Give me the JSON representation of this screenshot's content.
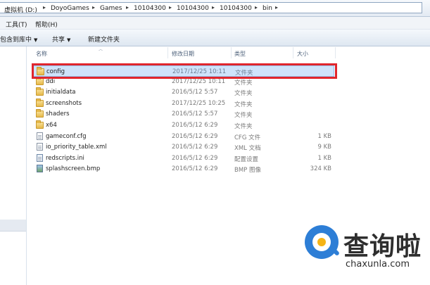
{
  "address_bar": {
    "crumbs": [
      "虚拟机 (D:)",
      "DoyoGames",
      "Games",
      "10104300",
      "10104300",
      "10104300",
      "bin"
    ]
  },
  "menu": {
    "items": [
      "工具(T)",
      "帮助(H)"
    ]
  },
  "toolbar": {
    "include_in_library": "包含到库中",
    "share": "共享",
    "new_folder": "新建文件夹"
  },
  "columns": {
    "name": "名称",
    "date": "修改日期",
    "type": "类型",
    "size": "大小"
  },
  "files": [
    {
      "name": "config",
      "date": "2017/12/25 10:11",
      "type": "文件夹",
      "size": "",
      "icon": "folder-icon",
      "selected": true
    },
    {
      "name": "ddi",
      "date": "2017/12/25 10:11",
      "type": "文件夹",
      "size": "",
      "icon": "folder-icon"
    },
    {
      "name": "initialdata",
      "date": "2016/5/12 5:57",
      "type": "文件夹",
      "size": "",
      "icon": "folder-icon"
    },
    {
      "name": "screenshots",
      "date": "2017/12/25 10:25",
      "type": "文件夹",
      "size": "",
      "icon": "folder-icon"
    },
    {
      "name": "shaders",
      "date": "2016/5/12 5:57",
      "type": "文件夹",
      "size": "",
      "icon": "folder-icon"
    },
    {
      "name": "x64",
      "date": "2016/5/12 6:29",
      "type": "文件夹",
      "size": "",
      "icon": "folder-icon"
    },
    {
      "name": "gameconf.cfg",
      "date": "2016/5/12 6:29",
      "type": "CFG 文件",
      "size": "1 KB",
      "icon": "file-icon"
    },
    {
      "name": "io_priority_table.xml",
      "date": "2016/5/12 6:29",
      "type": "XML 文档",
      "size": "9 KB",
      "icon": "xml-file-icon"
    },
    {
      "name": "redscripts.ini",
      "date": "2016/5/12 6:29",
      "type": "配置设置",
      "size": "1 KB",
      "icon": "settings-file-icon"
    },
    {
      "name": "splashscreen.bmp",
      "date": "2016/5/12 6:29",
      "type": "BMP 图像",
      "size": "324 KB",
      "icon": "image-file-icon"
    }
  ],
  "watermark": {
    "brand": "查询啦",
    "url": "chaxunla.com"
  },
  "colors": {
    "highlight": "#e0262d",
    "selection": "#cfe3fb",
    "watermark_blue": "#2d7ed6",
    "watermark_yellow": "#f5b417"
  }
}
